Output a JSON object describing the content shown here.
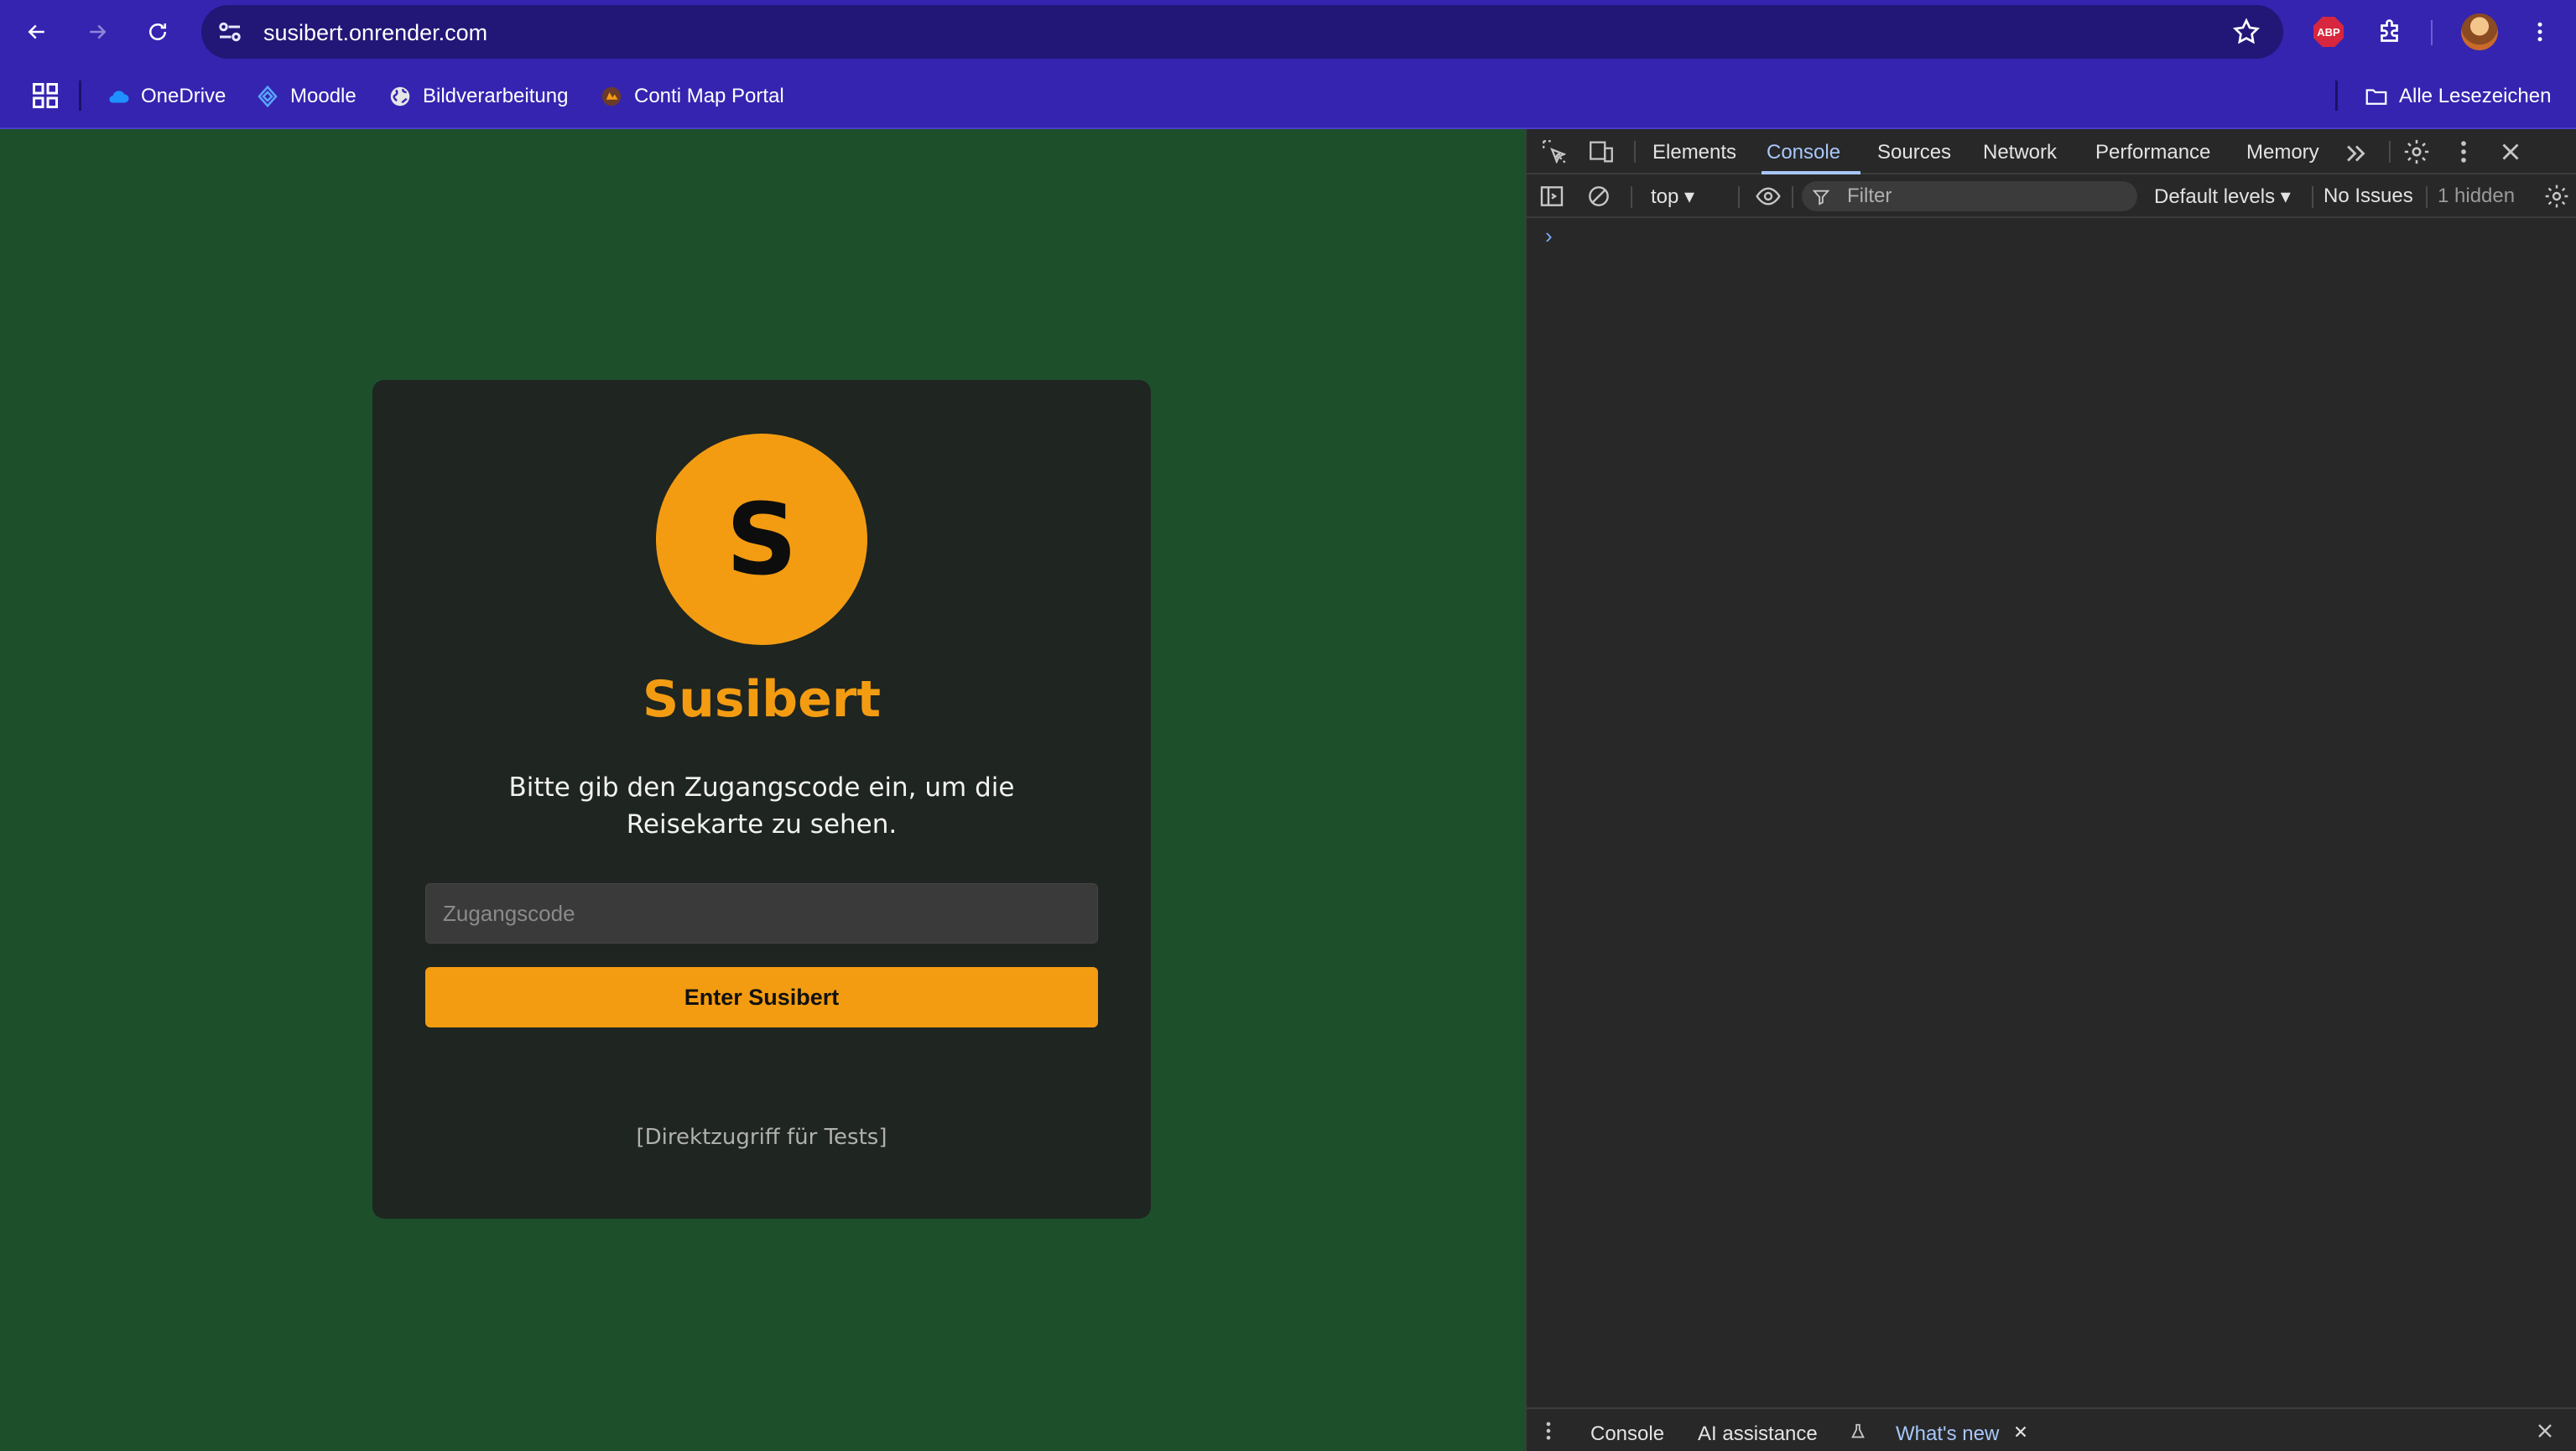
{
  "browser": {
    "url": "susibert.onrender.com",
    "bookmarks": [
      {
        "label": "OneDrive",
        "icon": "cloud-icon"
      },
      {
        "label": "Moodle",
        "icon": "moodle-icon"
      },
      {
        "label": "Bildverarbeitung",
        "icon": "globe-icon"
      },
      {
        "label": "Conti Map Portal",
        "icon": "map-portal-icon"
      }
    ],
    "all_bookmarks_label": "Alle Lesezeichen",
    "extension_badge": "ABP"
  },
  "page": {
    "logo_letter": "S",
    "title": "Susibert",
    "description": "Bitte gib den Zugangscode ein, um die Reisekarte zu sehen.",
    "code_input": {
      "placeholder": "Zugangscode",
      "value": ""
    },
    "enter_button": "Enter Susibert",
    "direct_access_link": "[Direktzugriff für Tests]",
    "colors": {
      "background": "#1d4f2b",
      "card": "#1f2520",
      "accent": "#f39c12",
      "input": "#3a3a3a"
    }
  },
  "devtools": {
    "tabs": [
      "Elements",
      "Console",
      "Sources",
      "Network",
      "Performance",
      "Memory"
    ],
    "active_tab": "Console",
    "context": "top",
    "filter_placeholder": "Filter",
    "levels": "Default levels",
    "issues": "No Issues",
    "hidden": "1 hidden",
    "prompt": "›",
    "drawer_tabs": [
      {
        "label": "Console"
      },
      {
        "label": "AI assistance"
      },
      {
        "label": "What's new"
      }
    ]
  }
}
